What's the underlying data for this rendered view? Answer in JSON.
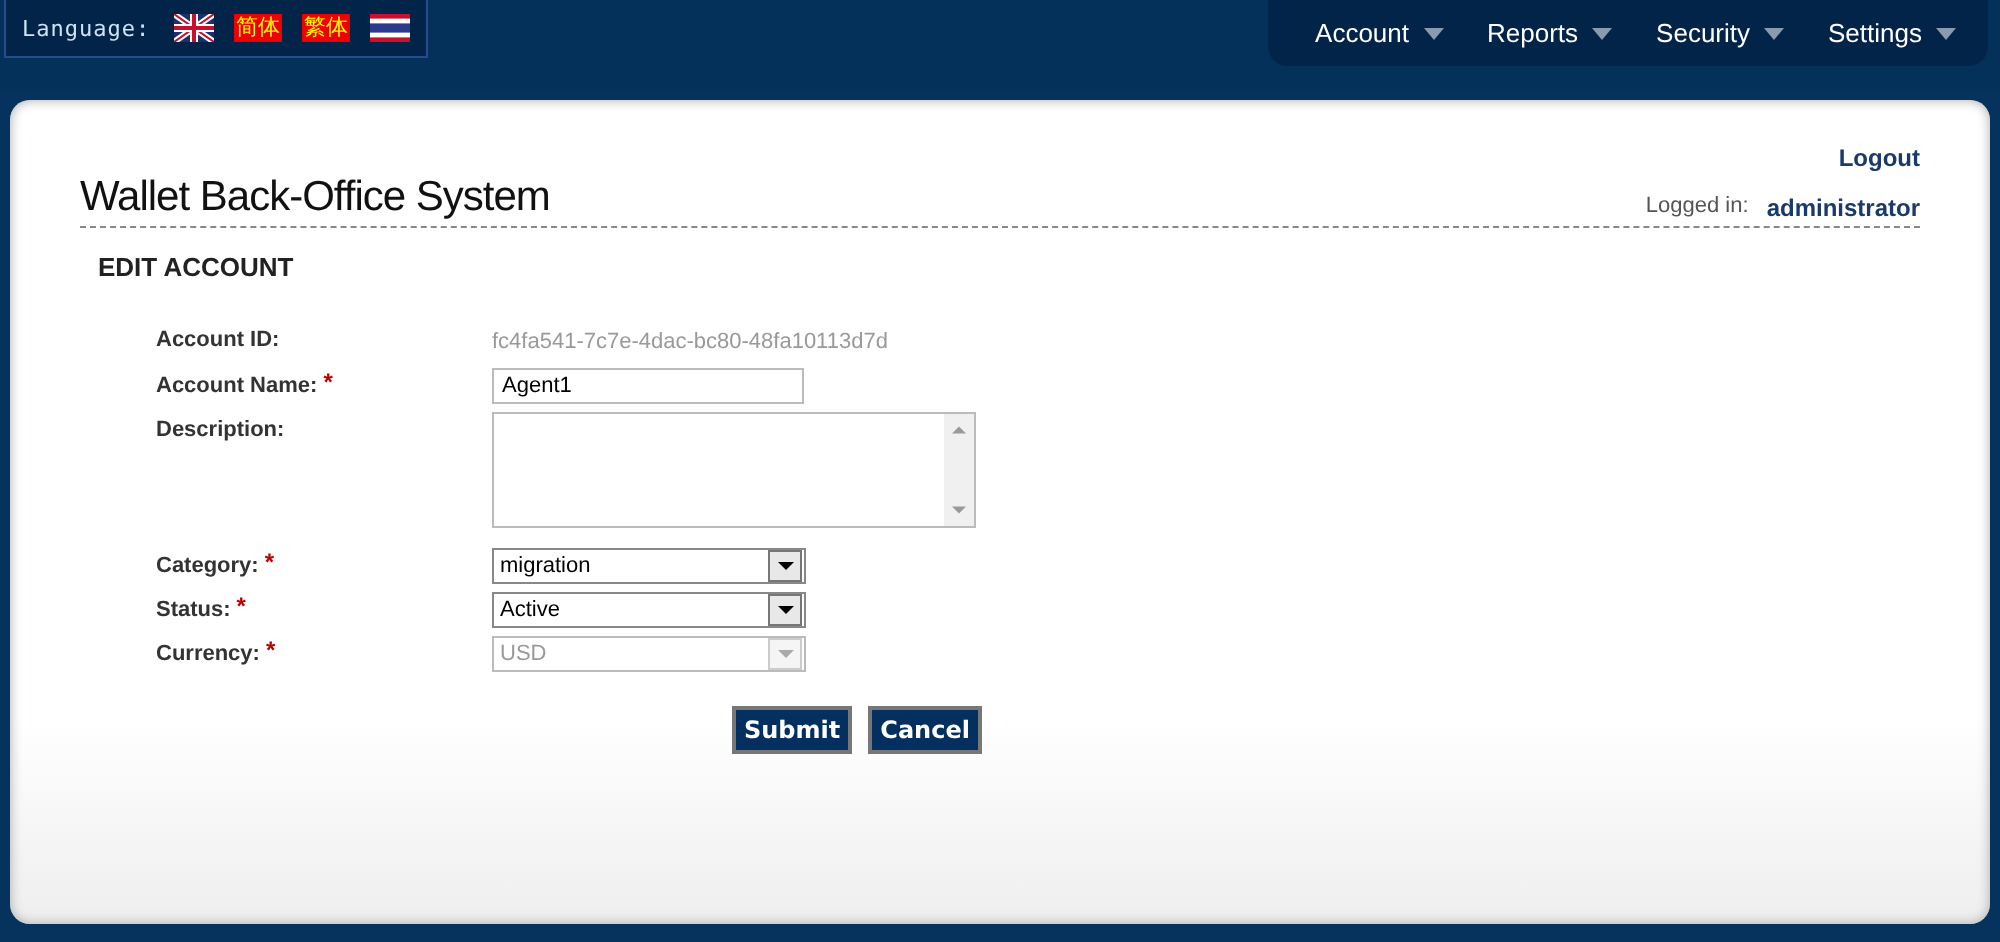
{
  "language_bar": {
    "label": "Language:",
    "options": [
      {
        "kind": "uk-flag"
      },
      {
        "kind": "text",
        "label": "简体"
      },
      {
        "kind": "text",
        "label": "繁体"
      },
      {
        "kind": "thai-flag"
      }
    ]
  },
  "menu": [
    "Account",
    "Reports",
    "Security",
    "Settings"
  ],
  "header": {
    "logout": "Logout",
    "title": "Wallet Back-Office System",
    "logged_in_label": "Logged in:",
    "user": "administrator"
  },
  "form": {
    "heading": "EDIT ACCOUNT",
    "fields": [
      {
        "kind": "readonly",
        "label": "Account ID:",
        "value": "fc4fa541-7c7e-4dac-bc80-48fa10113d7d"
      },
      {
        "kind": "text",
        "label": "Account Name:",
        "required_mark": "*",
        "value": "Agent1"
      },
      {
        "kind": "textarea",
        "label": "Description:"
      },
      {
        "kind": "select",
        "label": "Category:",
        "required_mark": "*",
        "value": "migration",
        "disabled": false
      },
      {
        "kind": "select",
        "label": "Status:",
        "required_mark": "*",
        "value": "Active",
        "disabled": false
      },
      {
        "kind": "select",
        "label": "Currency:",
        "required_mark": "*",
        "value": "USD",
        "disabled": true
      }
    ],
    "buttons": [
      "Submit",
      "Cancel"
    ]
  }
}
